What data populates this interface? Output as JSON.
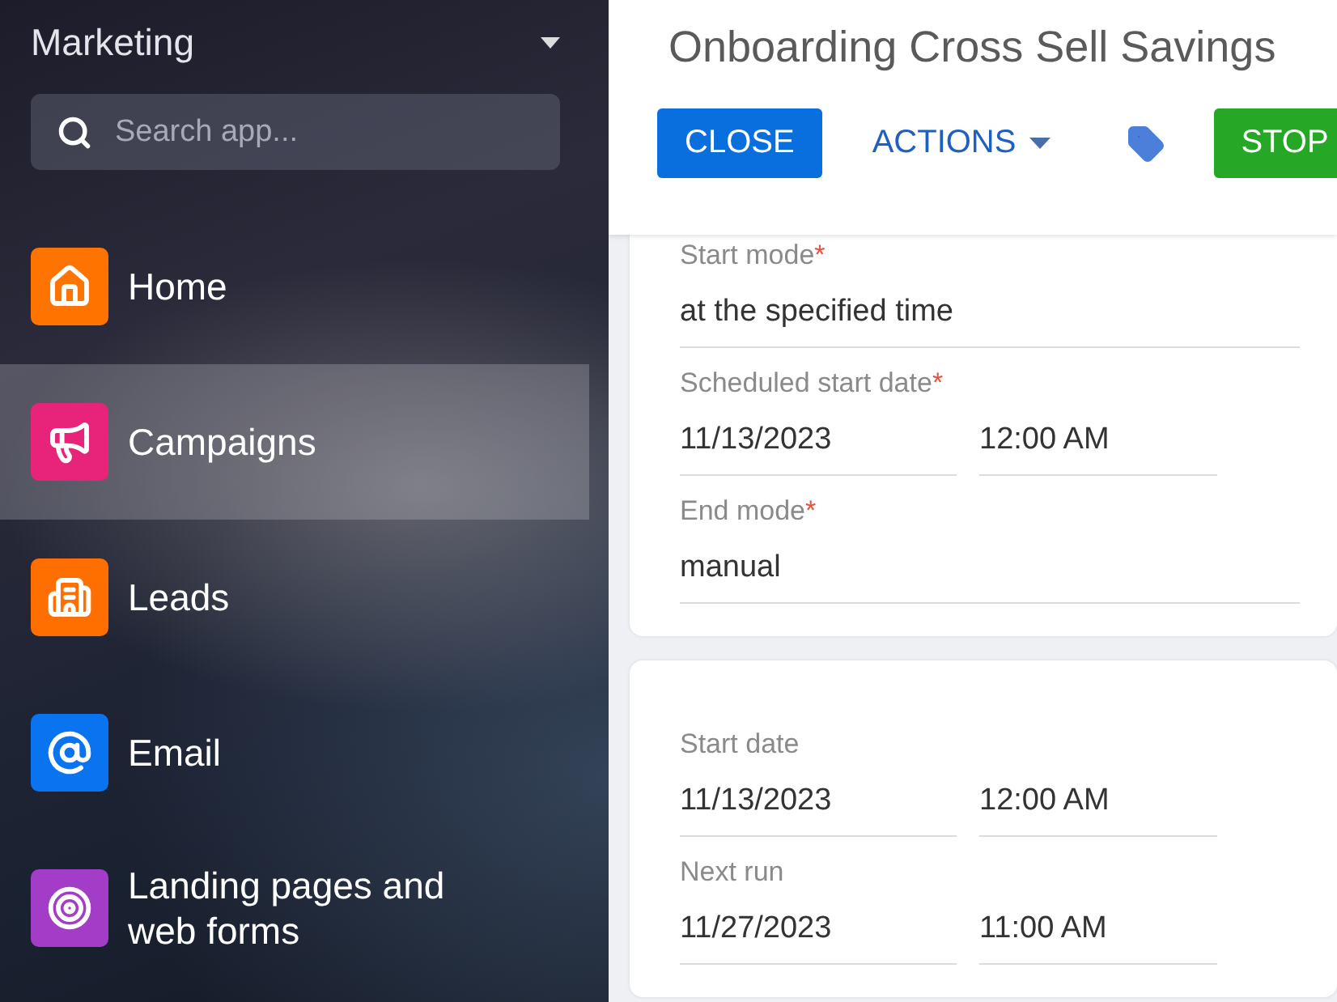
{
  "sidebar": {
    "title": "Marketing",
    "search": {
      "placeholder": "Search app..."
    },
    "items": [
      {
        "label": "Home",
        "kind": "home",
        "color": "#ff7400",
        "selected": false
      },
      {
        "label": "Campaigns",
        "kind": "campaigns",
        "color": "#e8237a",
        "selected": true
      },
      {
        "label": "Leads",
        "kind": "leads",
        "color": "#ff6f00",
        "selected": false
      },
      {
        "label": "Email",
        "kind": "email",
        "color": "#0a74f0",
        "selected": false
      },
      {
        "label": "Landing pages and web forms",
        "kind": "landing",
        "color": "#a33cc6",
        "selected": false
      }
    ]
  },
  "header": {
    "title": "Onboarding Cross Sell Savings",
    "buttons": [
      {
        "label": "CLOSE",
        "kind": "primary"
      },
      {
        "label": "ACTIONS",
        "kind": "menu"
      },
      {
        "kind": "tag"
      },
      {
        "label": "STOP",
        "kind": "success"
      }
    ]
  },
  "cards": [
    {
      "rows": [
        {
          "label": "Start mode",
          "required_mark": "*",
          "values": [
            "at the specified time"
          ]
        },
        {
          "label": "Scheduled start date",
          "required_mark": "*",
          "values": [
            "11/13/2023",
            "12:00 AM"
          ]
        },
        {
          "label": "End mode",
          "required_mark": "*",
          "values": [
            "manual"
          ]
        }
      ]
    },
    {
      "rows": [
        {
          "label": "Start date",
          "values": [
            "11/13/2023",
            "12:00 AM"
          ]
        },
        {
          "label": "Next run",
          "values": [
            "11/27/2023",
            "11:00 AM"
          ]
        }
      ]
    }
  ]
}
